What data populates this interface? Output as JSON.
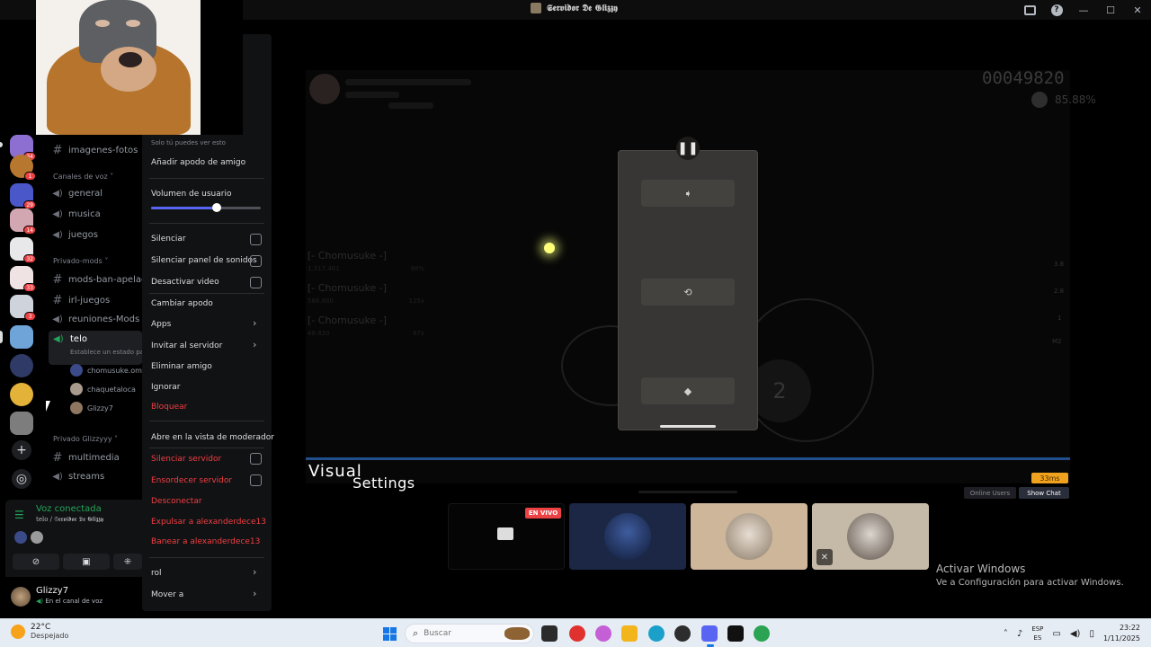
{
  "window": {
    "title": "𝕾𝖊𝖗𝖛𝖎𝖉𝖔𝖗 𝕯𝖊 𝕲𝖑𝖎𝖟𝖟𝖞",
    "controls": [
      "—",
      "☐",
      "✕"
    ],
    "help_glyph": "?"
  },
  "game": {
    "score": "00049820",
    "accuracy": "85.88%",
    "leaderboard": [
      {
        "name": "[- Chomusuke -]",
        "score": "1.317.461",
        "acc": "98%"
      },
      {
        "name": "[- Chomusuke -]",
        "score": "586.880",
        "acc": "125x"
      },
      {
        "name": "[- Chomusuke -]",
        "score": "48.820",
        "acc": "87x"
      }
    ],
    "combo_number": "2",
    "pause_glyph": "❚❚",
    "key_glyphs": [
      "➧",
      "⟲",
      "◆"
    ],
    "side_labels": [
      "3.8",
      "2.8",
      "1",
      "M2"
    ],
    "visual_title": "Visual",
    "settings_title": "Settings",
    "latency": "33ms",
    "online_users": "Online Users",
    "show_chat": "Show Chat"
  },
  "streams": {
    "live_badge": "EN VIVO",
    "colors": {
      "live": "#ed4245"
    }
  },
  "activation": {
    "title": "Activar Windows",
    "subtitle": "Ve a Configuración para activar Windows."
  },
  "servers": [
    {
      "badge": "34"
    },
    {
      "badge": "1"
    },
    {
      "badge": "29"
    },
    {
      "badge": "14"
    },
    {
      "badge": "32"
    },
    {
      "badge": "33"
    },
    {
      "badge": "3"
    },
    {
      "badge": ""
    },
    {
      "badge": ""
    },
    {
      "badge": ""
    },
    {
      "badge": ""
    }
  ],
  "rail_buttons": {
    "add": "+",
    "discover": "◎"
  },
  "channels": {
    "images": "imagenes-fotos",
    "voice_category": "Canales de voz",
    "voice": [
      "general",
      "musica",
      "juegos"
    ],
    "mods_category": "Privado-mods",
    "mods": [
      "mods-ban-apelaci",
      "irl-juegos",
      "reuniones-Mods"
    ],
    "active": {
      "name": "telo",
      "status": "Establece un estado pa"
    },
    "voice_users": [
      "chomusuke.om",
      "chaquetaloca",
      "Glizzy7"
    ],
    "glizzy_category": "Privado Glizzyyy",
    "glizzy": [
      "multimedia",
      "streams"
    ]
  },
  "context_menu": {
    "note": "Solo tú puedes ver esto",
    "add_nickname": "Añadir apodo de amigo",
    "volume_label": "Volumen de usuario",
    "volume": 0.6,
    "items": {
      "mute": "Silenciar",
      "mute_soundboard": "Silenciar panel de sonidos",
      "disable_video": "Desactivar video",
      "change_nickname": "Cambiar apodo",
      "apps": "Apps",
      "invite": "Invitar al servidor",
      "remove_friend": "Eliminar amigo",
      "ignore": "Ignorar",
      "block": "Bloquear",
      "mod_view": "Abre en la vista de moderador",
      "server_mute": "Silenciar servidor",
      "server_deafen": "Ensordecer servidor",
      "disconnect": "Desconectar",
      "kick": "Expulsar a alexanderdece13",
      "ban": "Banear a alexanderdece13",
      "role": "rol",
      "move": "Mover a"
    },
    "colors": {
      "danger": "#f23f43",
      "accent": "#5865f2"
    }
  },
  "voice_panel": {
    "title": "Voz conectada",
    "location": "telo / 𝕾𝖊𝖗𝖛𝖎𝖉𝖔𝖗 𝕯𝖊 𝕲𝖑𝖎𝖟𝖟𝖞",
    "color": "#23a55a"
  },
  "user": {
    "name": "Glizzy7",
    "status": "En el canal de voz"
  },
  "taskbar": {
    "weather_temp": "22°C",
    "weather_desc": "Despejado",
    "search_placeholder": "Buscar",
    "lang_top": "ESP",
    "lang_bottom": "ES",
    "time": "23:22",
    "date": "1/11/2025",
    "colors": {
      "windows_blue": "#1677e6"
    }
  }
}
